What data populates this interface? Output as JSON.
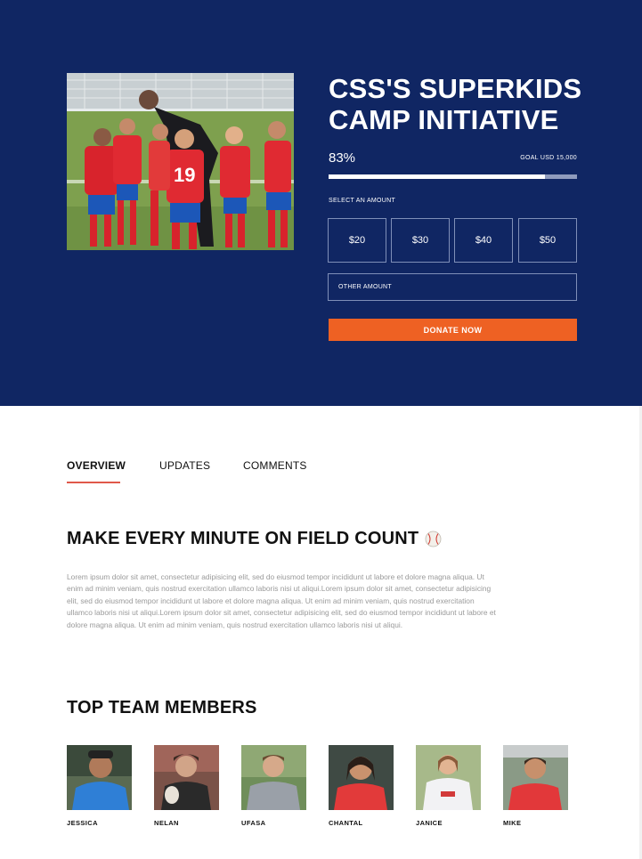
{
  "campaign": {
    "title": "CSS'S SUPERKIDS CAMP INITIATIVE",
    "progress_percent_label": "83%",
    "progress_fraction": 0.87,
    "goal_label": "GOAL USD 15,000",
    "select_amount_label": "SELECT AN AMOUNT",
    "amounts": [
      "$20",
      "$30",
      "$40",
      "$50"
    ],
    "other_amount_placeholder": "OTHER AMOUNT",
    "donate_label": "DONATE NOW",
    "photo_icon": "soccer-team-photo"
  },
  "tabs": [
    {
      "label": "OVERVIEW",
      "active": true
    },
    {
      "label": "UPDATES",
      "active": false
    },
    {
      "label": "COMMENTS",
      "active": false
    }
  ],
  "overview": {
    "heading": "MAKE EVERY MINUTE ON FIELD COUNT",
    "heading_icon": "baseball-icon",
    "body": "Lorem ipsum dolor sit amet, consectetur adipisicing elit, sed do eiusmod tempor incididunt ut labore et dolore magna aliqua. Ut enim ad minim veniam, quis nostrud exercitation ullamco laboris nisi ut aliqui.Lorem ipsum dolor sit amet, consectetur adipisicing elit, sed do eiusmod tempor incididunt ut labore et dolore magna aliqua. Ut enim ad minim veniam, quis nostrud exercitation ullamco laboris nisi ut aliqui.Lorem ipsum dolor sit amet, consectetur adipisicing elit, sed do eiusmod tempor incididunt ut labore et dolore magna aliqua. Ut enim ad minim veniam, quis nostrud exercitation ullamco laboris nisi ut aliqui."
  },
  "team": {
    "heading": "TOP TEAM MEMBERS",
    "members": [
      {
        "name": "JESSICA"
      },
      {
        "name": "NELAN"
      },
      {
        "name": "UFASA"
      },
      {
        "name": "CHANTAL"
      },
      {
        "name": "JANICE"
      },
      {
        "name": "MIKE"
      }
    ]
  },
  "colors": {
    "hero_bg": "#102663",
    "accent_orange": "#ee6123",
    "tab_indicator": "#e0584a"
  }
}
